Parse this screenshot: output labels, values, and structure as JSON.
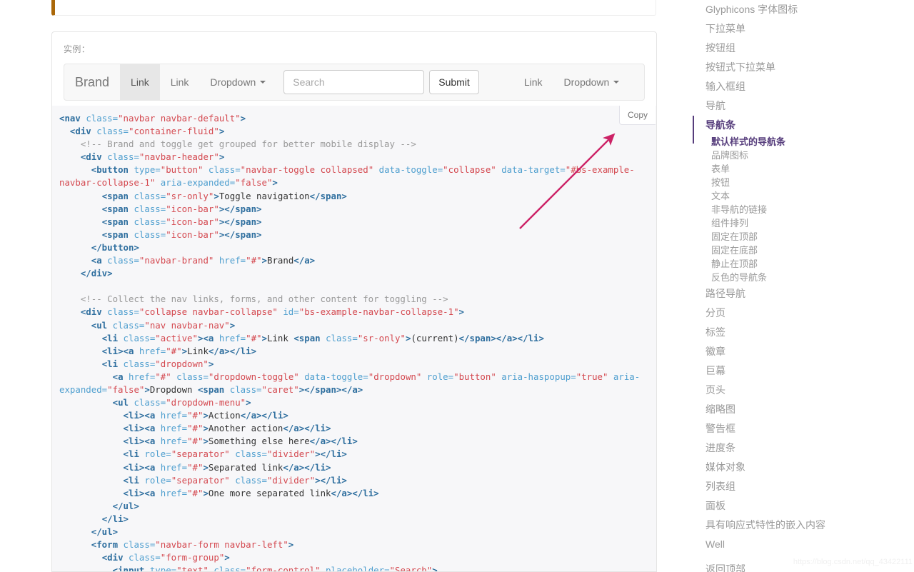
{
  "example_panel": {
    "label": "实例：",
    "navbar_demo": {
      "brand": "Brand",
      "link_active": "Link",
      "link_second": "Link",
      "dropdown_left": "Dropdown",
      "search_placeholder": "Search",
      "search_value": "",
      "submit": "Submit",
      "link_right": "Link",
      "dropdown_right": "Dropdown"
    }
  },
  "code_block": {
    "copy_label": "Copy",
    "lines": [
      [
        [
          "t",
          "<nav "
        ],
        [
          "a",
          "class="
        ],
        [
          "v",
          "\"navbar navbar-default\""
        ],
        [
          "t",
          ">"
        ]
      ],
      [
        [
          "x",
          "  "
        ],
        [
          "t",
          "<div "
        ],
        [
          "a",
          "class="
        ],
        [
          "v",
          "\"container-fluid\""
        ],
        [
          "t",
          ">"
        ]
      ],
      [
        [
          "x",
          "    "
        ],
        [
          "c",
          "<!-- Brand and toggle get grouped for better mobile display -->"
        ]
      ],
      [
        [
          "x",
          "    "
        ],
        [
          "t",
          "<div "
        ],
        [
          "a",
          "class="
        ],
        [
          "v",
          "\"navbar-header\""
        ],
        [
          "t",
          ">"
        ]
      ],
      [
        [
          "x",
          "      "
        ],
        [
          "t",
          "<button "
        ],
        [
          "a",
          "type="
        ],
        [
          "v",
          "\"button\""
        ],
        [
          "a",
          " class="
        ],
        [
          "v",
          "\"navbar-toggle collapsed\""
        ],
        [
          "a",
          " data-toggle="
        ],
        [
          "v",
          "\"collapse\""
        ],
        [
          "a",
          " data-target="
        ],
        [
          "v",
          "\"#bs-example-navbar-collapse-1\""
        ],
        [
          "a",
          " aria-expanded="
        ],
        [
          "v",
          "\"false\""
        ],
        [
          "t",
          ">"
        ]
      ],
      [
        [
          "x",
          "        "
        ],
        [
          "t",
          "<span "
        ],
        [
          "a",
          "class="
        ],
        [
          "v",
          "\"sr-only\""
        ],
        [
          "t",
          ">"
        ],
        [
          "x",
          "Toggle navigation"
        ],
        [
          "t",
          "</span>"
        ]
      ],
      [
        [
          "x",
          "        "
        ],
        [
          "t",
          "<span "
        ],
        [
          "a",
          "class="
        ],
        [
          "v",
          "\"icon-bar\""
        ],
        [
          "t",
          "></span>"
        ]
      ],
      [
        [
          "x",
          "        "
        ],
        [
          "t",
          "<span "
        ],
        [
          "a",
          "class="
        ],
        [
          "v",
          "\"icon-bar\""
        ],
        [
          "t",
          "></span>"
        ]
      ],
      [
        [
          "x",
          "        "
        ],
        [
          "t",
          "<span "
        ],
        [
          "a",
          "class="
        ],
        [
          "v",
          "\"icon-bar\""
        ],
        [
          "t",
          "></span>"
        ]
      ],
      [
        [
          "x",
          "      "
        ],
        [
          "t",
          "</button>"
        ]
      ],
      [
        [
          "x",
          "      "
        ],
        [
          "t",
          "<a "
        ],
        [
          "a",
          "class="
        ],
        [
          "v",
          "\"navbar-brand\""
        ],
        [
          "a",
          " href="
        ],
        [
          "v",
          "\"#\""
        ],
        [
          "t",
          ">"
        ],
        [
          "x",
          "Brand"
        ],
        [
          "t",
          "</a>"
        ]
      ],
      [
        [
          "x",
          "    "
        ],
        [
          "t",
          "</div>"
        ]
      ],
      [
        [
          "x",
          ""
        ]
      ],
      [
        [
          "x",
          "    "
        ],
        [
          "c",
          "<!-- Collect the nav links, forms, and other content for toggling -->"
        ]
      ],
      [
        [
          "x",
          "    "
        ],
        [
          "t",
          "<div "
        ],
        [
          "a",
          "class="
        ],
        [
          "v",
          "\"collapse navbar-collapse\""
        ],
        [
          "a",
          " id="
        ],
        [
          "v",
          "\"bs-example-navbar-collapse-1\""
        ],
        [
          "t",
          ">"
        ]
      ],
      [
        [
          "x",
          "      "
        ],
        [
          "t",
          "<ul "
        ],
        [
          "a",
          "class="
        ],
        [
          "v",
          "\"nav navbar-nav\""
        ],
        [
          "t",
          ">"
        ]
      ],
      [
        [
          "x",
          "        "
        ],
        [
          "t",
          "<li "
        ],
        [
          "a",
          "class="
        ],
        [
          "v",
          "\"active\""
        ],
        [
          "t",
          "><a "
        ],
        [
          "a",
          "href="
        ],
        [
          "v",
          "\"#\""
        ],
        [
          "t",
          ">"
        ],
        [
          "x",
          "Link "
        ],
        [
          "t",
          "<span "
        ],
        [
          "a",
          "class="
        ],
        [
          "v",
          "\"sr-only\""
        ],
        [
          "t",
          ">"
        ],
        [
          "x",
          "(current)"
        ],
        [
          "t",
          "</span></a></li>"
        ]
      ],
      [
        [
          "x",
          "        "
        ],
        [
          "t",
          "<li><a "
        ],
        [
          "a",
          "href="
        ],
        [
          "v",
          "\"#\""
        ],
        [
          "t",
          ">"
        ],
        [
          "x",
          "Link"
        ],
        [
          "t",
          "</a></li>"
        ]
      ],
      [
        [
          "x",
          "        "
        ],
        [
          "t",
          "<li "
        ],
        [
          "a",
          "class="
        ],
        [
          "v",
          "\"dropdown\""
        ],
        [
          "t",
          ">"
        ]
      ],
      [
        [
          "x",
          "          "
        ],
        [
          "t",
          "<a "
        ],
        [
          "a",
          "href="
        ],
        [
          "v",
          "\"#\""
        ],
        [
          "a",
          " class="
        ],
        [
          "v",
          "\"dropdown-toggle\""
        ],
        [
          "a",
          " data-toggle="
        ],
        [
          "v",
          "\"dropdown\""
        ],
        [
          "a",
          " role="
        ],
        [
          "v",
          "\"button\""
        ],
        [
          "a",
          " aria-haspopup="
        ],
        [
          "v",
          "\"true\""
        ],
        [
          "a",
          " aria-expanded="
        ],
        [
          "v",
          "\"false\""
        ],
        [
          "t",
          ">"
        ],
        [
          "x",
          "Dropdown "
        ],
        [
          "t",
          "<span "
        ],
        [
          "a",
          "class="
        ],
        [
          "v",
          "\"caret\""
        ],
        [
          "t",
          "></span></a>"
        ]
      ],
      [
        [
          "x",
          "          "
        ],
        [
          "t",
          "<ul "
        ],
        [
          "a",
          "class="
        ],
        [
          "v",
          "\"dropdown-menu\""
        ],
        [
          "t",
          ">"
        ]
      ],
      [
        [
          "x",
          "            "
        ],
        [
          "t",
          "<li><a "
        ],
        [
          "a",
          "href="
        ],
        [
          "v",
          "\"#\""
        ],
        [
          "t",
          ">"
        ],
        [
          "x",
          "Action"
        ],
        [
          "t",
          "</a></li>"
        ]
      ],
      [
        [
          "x",
          "            "
        ],
        [
          "t",
          "<li><a "
        ],
        [
          "a",
          "href="
        ],
        [
          "v",
          "\"#\""
        ],
        [
          "t",
          ">"
        ],
        [
          "x",
          "Another action"
        ],
        [
          "t",
          "</a></li>"
        ]
      ],
      [
        [
          "x",
          "            "
        ],
        [
          "t",
          "<li><a "
        ],
        [
          "a",
          "href="
        ],
        [
          "v",
          "\"#\""
        ],
        [
          "t",
          ">"
        ],
        [
          "x",
          "Something else here"
        ],
        [
          "t",
          "</a></li>"
        ]
      ],
      [
        [
          "x",
          "            "
        ],
        [
          "t",
          "<li "
        ],
        [
          "a",
          "role="
        ],
        [
          "v",
          "\"separator\""
        ],
        [
          "a",
          " class="
        ],
        [
          "v",
          "\"divider\""
        ],
        [
          "t",
          "></li>"
        ]
      ],
      [
        [
          "x",
          "            "
        ],
        [
          "t",
          "<li><a "
        ],
        [
          "a",
          "href="
        ],
        [
          "v",
          "\"#\""
        ],
        [
          "t",
          ">"
        ],
        [
          "x",
          "Separated link"
        ],
        [
          "t",
          "</a></li>"
        ]
      ],
      [
        [
          "x",
          "            "
        ],
        [
          "t",
          "<li "
        ],
        [
          "a",
          "role="
        ],
        [
          "v",
          "\"separator\""
        ],
        [
          "a",
          " class="
        ],
        [
          "v",
          "\"divider\""
        ],
        [
          "t",
          "></li>"
        ]
      ],
      [
        [
          "x",
          "            "
        ],
        [
          "t",
          "<li><a "
        ],
        [
          "a",
          "href="
        ],
        [
          "v",
          "\"#\""
        ],
        [
          "t",
          ">"
        ],
        [
          "x",
          "One more separated link"
        ],
        [
          "t",
          "</a></li>"
        ]
      ],
      [
        [
          "x",
          "          "
        ],
        [
          "t",
          "</ul>"
        ]
      ],
      [
        [
          "x",
          "        "
        ],
        [
          "t",
          "</li>"
        ]
      ],
      [
        [
          "x",
          "      "
        ],
        [
          "t",
          "</ul>"
        ]
      ],
      [
        [
          "x",
          "      "
        ],
        [
          "t",
          "<form "
        ],
        [
          "a",
          "class="
        ],
        [
          "v",
          "\"navbar-form navbar-left\""
        ],
        [
          "t",
          ">"
        ]
      ],
      [
        [
          "x",
          "        "
        ],
        [
          "t",
          "<div "
        ],
        [
          "a",
          "class="
        ],
        [
          "v",
          "\"form-group\""
        ],
        [
          "t",
          ">"
        ]
      ],
      [
        [
          "x",
          "          "
        ],
        [
          "t",
          "<input "
        ],
        [
          "a",
          "type="
        ],
        [
          "v",
          "\"text\""
        ],
        [
          "a",
          " class="
        ],
        [
          "v",
          "\"form-control\""
        ],
        [
          "a",
          " placeholder="
        ],
        [
          "v",
          "\"Search\""
        ],
        [
          "t",
          ">"
        ]
      ]
    ]
  },
  "sidebar": {
    "items": [
      {
        "label": "Glyphicons 字体图标",
        "active": false,
        "children": []
      },
      {
        "label": "下拉菜单",
        "active": false,
        "children": []
      },
      {
        "label": "按钮组",
        "active": false,
        "children": []
      },
      {
        "label": "按钮式下拉菜单",
        "active": false,
        "children": []
      },
      {
        "label": "输入框组",
        "active": false,
        "children": []
      },
      {
        "label": "导航",
        "active": false,
        "children": []
      },
      {
        "label": "导航条",
        "active": true,
        "children": [
          {
            "label": "默认样式的导航条",
            "active": true
          },
          {
            "label": "品牌图标",
            "active": false
          },
          {
            "label": "表单",
            "active": false
          },
          {
            "label": "按钮",
            "active": false
          },
          {
            "label": "文本",
            "active": false
          },
          {
            "label": "非导航的链接",
            "active": false
          },
          {
            "label": "组件排列",
            "active": false
          },
          {
            "label": "固定在顶部",
            "active": false
          },
          {
            "label": "固定在底部",
            "active": false
          },
          {
            "label": "静止在顶部",
            "active": false
          },
          {
            "label": "反色的导航条",
            "active": false
          }
        ]
      },
      {
        "label": "路径导航",
        "active": false,
        "children": []
      },
      {
        "label": "分页",
        "active": false,
        "children": []
      },
      {
        "label": "标签",
        "active": false,
        "children": []
      },
      {
        "label": "徽章",
        "active": false,
        "children": []
      },
      {
        "label": "巨幕",
        "active": false,
        "children": []
      },
      {
        "label": "页头",
        "active": false,
        "children": []
      },
      {
        "label": "缩略图",
        "active": false,
        "children": []
      },
      {
        "label": "警告框",
        "active": false,
        "children": []
      },
      {
        "label": "进度条",
        "active": false,
        "children": []
      },
      {
        "label": "媒体对象",
        "active": false,
        "children": []
      },
      {
        "label": "列表组",
        "active": false,
        "children": []
      },
      {
        "label": "面板",
        "active": false,
        "children": []
      },
      {
        "label": "具有响应式特性的嵌入内容",
        "active": false,
        "children": []
      },
      {
        "label": "Well",
        "active": false,
        "children": []
      }
    ],
    "back_to_top": "返回顶部"
  },
  "watermark": "https://blog.csdn.net/qq_43422111",
  "colors": {
    "accent_purple": "#563d7c",
    "annotation_pink": "#cc2266",
    "callout_orange": "#aa6708",
    "code_bg": "#f7f7f9",
    "tag": "#2f6f9f",
    "attr": "#4f9fcf",
    "value": "#d44950",
    "comment": "#999999"
  }
}
